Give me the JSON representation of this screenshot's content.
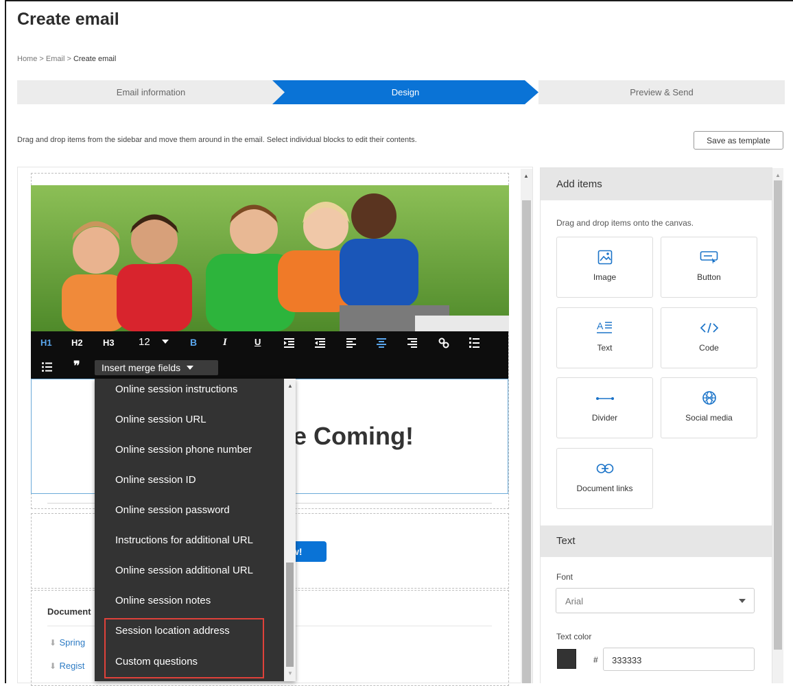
{
  "page": {
    "title": "Create email"
  },
  "breadcrumb": {
    "home": "Home",
    "sep": " > ",
    "email": "Email",
    "current": "Create email"
  },
  "steps": [
    {
      "label": "Email information",
      "state": "done"
    },
    {
      "label": "Design",
      "state": "active"
    },
    {
      "label": "Preview & Send",
      "state": "pending"
    }
  ],
  "instructions": "Drag and drop items from the sidebar and move them around in the email. Select individual blocks to edit their contents.",
  "save_template_label": "Save as template",
  "toolbar": {
    "h1": "H1",
    "h2": "H2",
    "h3": "H3",
    "font_size": "12",
    "bold": "B",
    "italic": "I",
    "underline": "U",
    "merge_label": "Insert merge fields"
  },
  "canvas": {
    "heading_fragment": "re Coming!",
    "button_fragment": "w!",
    "documents_fragment": "Document",
    "doc_links": [
      "Spring",
      "Regist"
    ]
  },
  "merge_fields": [
    "Online session instructions",
    "Online session URL",
    "Online session phone number",
    "Online session ID",
    "Online session password",
    "Instructions for additional URL",
    "Online session additional URL",
    "Online session notes",
    "Session location address",
    "Custom questions"
  ],
  "sidebar": {
    "add_items_title": "Add items",
    "add_items_hint": "Drag and drop items onto the canvas.",
    "tiles": [
      {
        "label": "Image",
        "icon": "image-icon"
      },
      {
        "label": "Button",
        "icon": "button-icon"
      },
      {
        "label": "Text",
        "icon": "text-icon"
      },
      {
        "label": "Code",
        "icon": "code-icon"
      },
      {
        "label": "Divider",
        "icon": "divider-icon"
      },
      {
        "label": "Social media",
        "icon": "globe-icon"
      },
      {
        "label": "Document links",
        "icon": "link-icon"
      }
    ],
    "text_title": "Text",
    "font_label": "Font",
    "font_value": "Arial",
    "text_color_label": "Text color",
    "hash": "#",
    "text_color_value": "333333"
  },
  "colors": {
    "accent": "#0a73d6",
    "highlight": "#e0413a",
    "toolbar": "#0d0d0d",
    "dropdown": "#333333"
  }
}
